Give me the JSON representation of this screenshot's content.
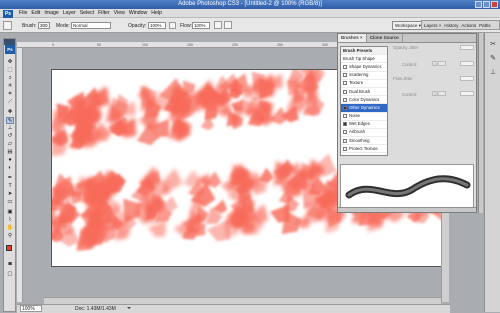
{
  "window": {
    "title": "Adobe Photoshop CS3 - [Untitled-2 @ 100% (RGB/8)]"
  },
  "menu": {
    "logo": "Ps",
    "items": [
      "File",
      "Edit",
      "Image",
      "Layer",
      "Select",
      "Filter",
      "View",
      "Window",
      "Help"
    ]
  },
  "options": {
    "brush_label": "Brush:",
    "brush_size": "300",
    "mode_label": "Mode:",
    "mode_value": "Normal",
    "opacity_label": "Opacity:",
    "opacity_value": "100%",
    "flow_label": "Flow:",
    "flow_value": "100%",
    "workspace_label": "Workspace ▾"
  },
  "right_tabs": [
    "Layers ×",
    "History",
    "Actions",
    "Paths"
  ],
  "brushes_panel": {
    "tabs": [
      "Brushes ×",
      "Clone Source"
    ],
    "list": [
      {
        "label": "Brush Presets",
        "type": "head"
      },
      {
        "label": "Brush Tip Shape",
        "type": "plain"
      },
      {
        "label": "Shape Dynamics",
        "type": "check",
        "checked": false
      },
      {
        "label": "Scattering",
        "type": "check",
        "checked": false
      },
      {
        "label": "Texture",
        "type": "check",
        "checked": false
      },
      {
        "label": "Dual Brush",
        "type": "check",
        "checked": false
      },
      {
        "label": "Color Dynamics",
        "type": "check",
        "checked": false
      },
      {
        "label": "Other Dynamics",
        "type": "check",
        "checked": true,
        "selected": true
      },
      {
        "label": "Noise",
        "type": "check",
        "checked": false
      },
      {
        "label": "Wet Edges",
        "type": "check",
        "checked": true
      },
      {
        "label": "Airbrush",
        "type": "check",
        "checked": false
      },
      {
        "label": "Smoothing",
        "type": "check",
        "checked": false
      },
      {
        "label": "Protect Texture",
        "type": "check",
        "checked": false
      }
    ],
    "right_rows": [
      {
        "label": "Opacity Jitter",
        "slot": ""
      },
      {
        "label": "Control:",
        "slot": "Off"
      },
      {
        "label": "Flow Jitter",
        "slot": ""
      },
      {
        "label": "Control:",
        "slot": "Off"
      }
    ]
  },
  "status": {
    "zoom": "100%",
    "doc": "Doc: 1.43M/1.43M"
  },
  "ruler_ticks": [
    "0",
    "50",
    "100",
    "150",
    "200",
    "250",
    "300",
    "350",
    "400",
    "450"
  ],
  "colors": {
    "paint": "#f86b5a",
    "accent": "#3168c6",
    "foreground": "#e4412f",
    "background": "#ffffff"
  }
}
